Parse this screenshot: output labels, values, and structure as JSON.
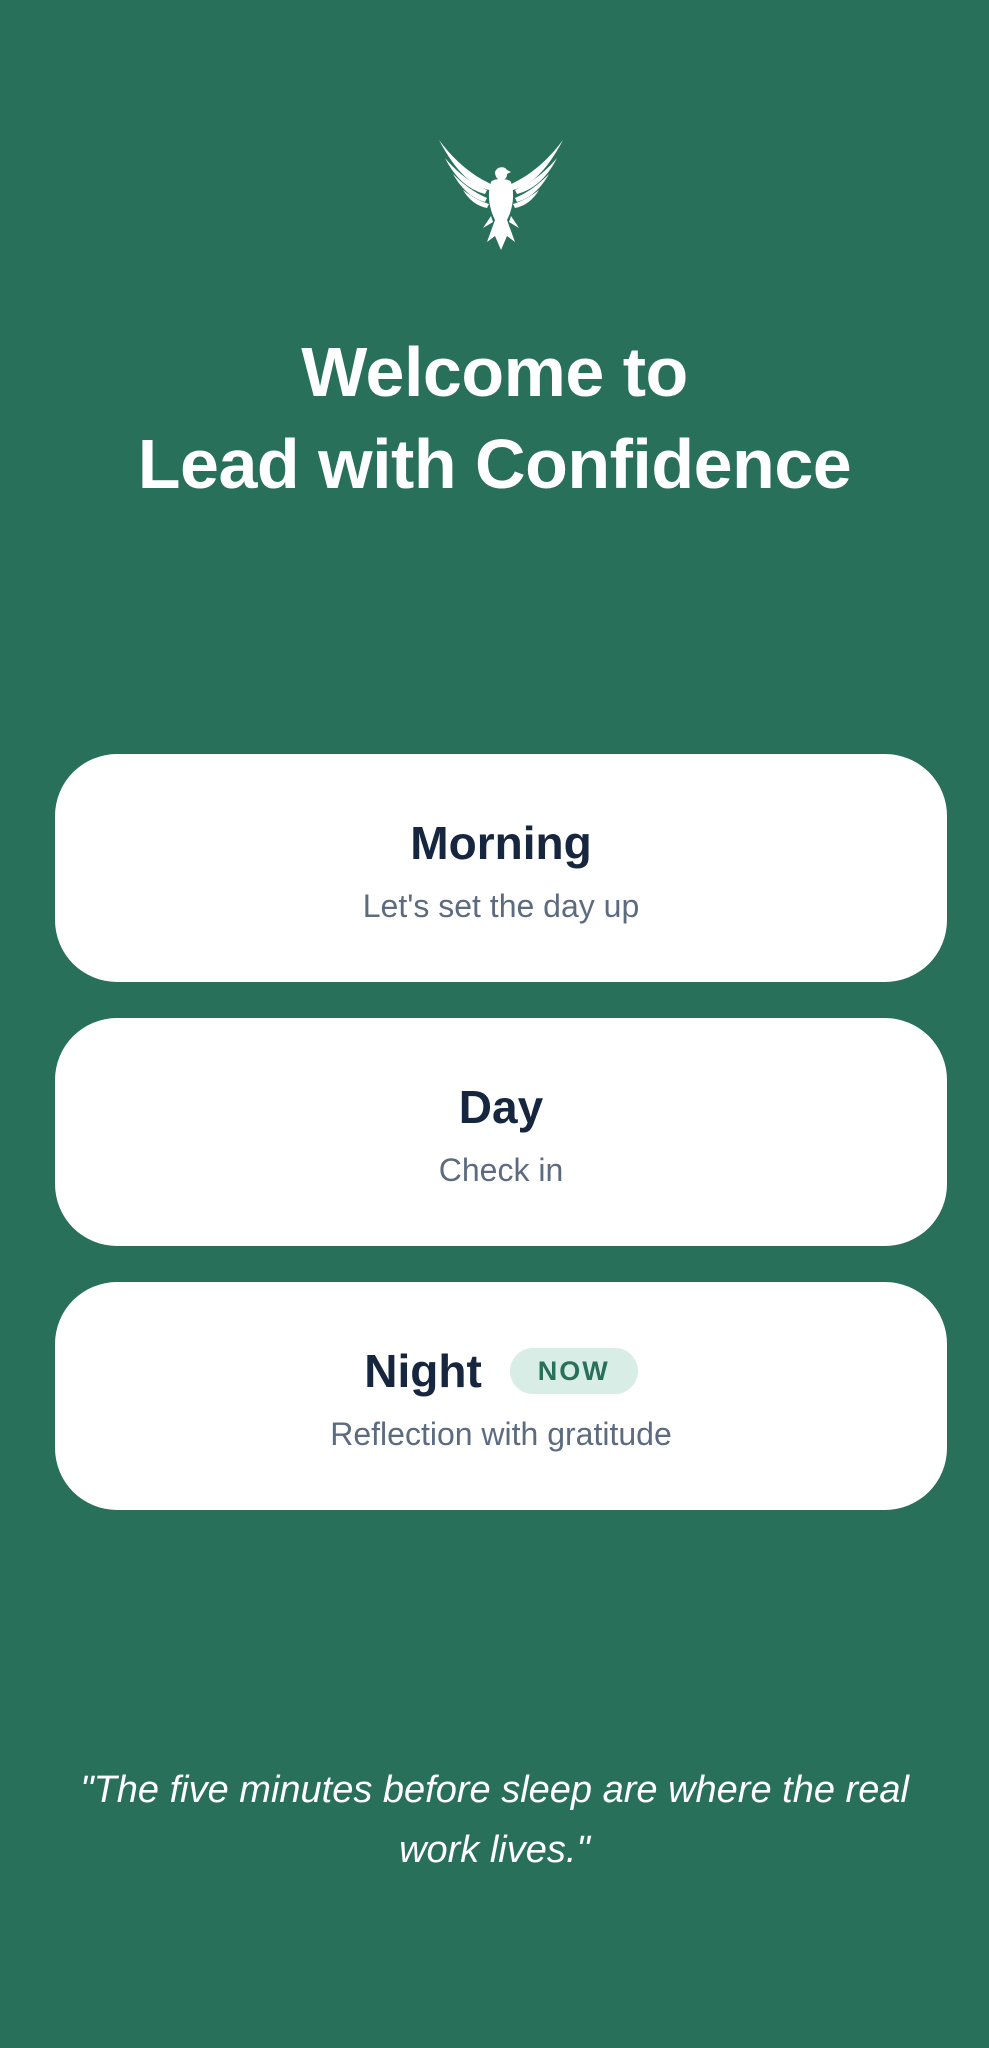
{
  "header": {
    "logo_icon": "eagle-icon",
    "title_line1": "Welcome to",
    "title_line2": "Lead with Confidence"
  },
  "cards": [
    {
      "title": "Morning",
      "subtitle": "Let's set the day up"
    },
    {
      "title": "Day",
      "subtitle": "Check in"
    },
    {
      "title": "Night",
      "subtitle": "Reflection with gratitude",
      "badge": "NOW"
    }
  ],
  "quote": "\"The five minutes before sleep are where the real work lives.\"",
  "colors": {
    "background": "#29705a",
    "card": "#ffffff",
    "card_title": "#16263f",
    "card_subtitle": "#5d6b80",
    "badge_bg": "#d8ede5",
    "badge_text": "#29705a"
  }
}
